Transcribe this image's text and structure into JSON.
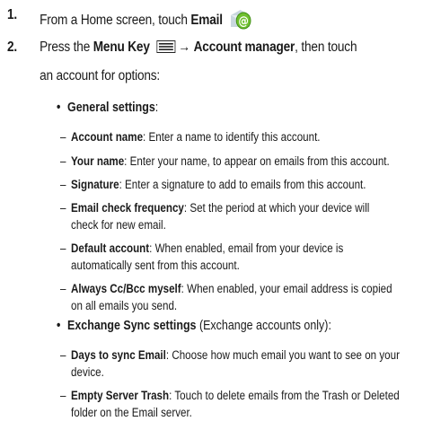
{
  "steps": [
    {
      "num": "1.",
      "pre": "From a Home screen, touch ",
      "bold": "Email",
      "icon": "email-app-icon"
    },
    {
      "num": "2.",
      "pre": "Press the ",
      "menu_key": "Menu Key",
      "icon": "menu-key-icon",
      "arrow": "→",
      "account_manager": "Account manager",
      "post_line1": ", then touch",
      "line2": "an account for options:"
    }
  ],
  "general": {
    "title": "General settings",
    "suffix": ":",
    "items": [
      {
        "label": "Account name",
        "desc": ": Enter a name to identify this account."
      },
      {
        "label": "Your name",
        "desc": ": Enter your name, to appear on emails from this account."
      },
      {
        "label": "Signature",
        "desc": ": Enter a signature to add to emails from this account."
      },
      {
        "label": "Email check frequency",
        "desc": ": Set the period at which your device will",
        "cont": "check for new email."
      },
      {
        "label": "Default account",
        "desc": ": When enabled, email from your device is",
        "cont": "automatically sent from this account."
      },
      {
        "label": "Always Cc/Bcc myself",
        "desc": ": When enabled, your email address is copied",
        "cont": "on all emails you send."
      }
    ]
  },
  "exchange": {
    "title": "Exchange Sync settings",
    "note": " (Exchange accounts only):",
    "items": [
      {
        "label": "Days to sync Email",
        "desc": ": Choose how much email you want to see on your",
        "cont": "device."
      },
      {
        "label": "Empty Server Trash",
        "desc": ": Touch to delete emails from the Trash or Deleted",
        "cont": "folder on the Email server."
      }
    ]
  },
  "glyphs": {
    "bullet": "•",
    "dash": "–"
  }
}
